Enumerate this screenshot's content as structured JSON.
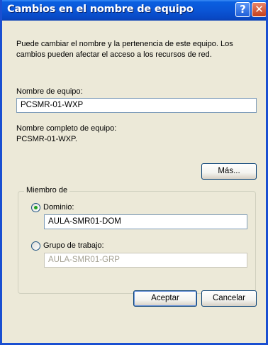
{
  "window": {
    "title": "Cambios en el nombre de equipo",
    "help_glyph": "?",
    "close_glyph": "✕"
  },
  "description": "Puede cambiar el nombre y la pertenencia de este equipo. Los cambios pueden afectar el acceso a los recursos de red.",
  "computer_name": {
    "label": "Nombre de equipo:",
    "value": "PCSMR-01-WXP"
  },
  "full_name": {
    "label": "Nombre completo de equipo:",
    "value": "PCSMR-01-WXP."
  },
  "buttons": {
    "more": "Más...",
    "ok": "Aceptar",
    "cancel": "Cancelar"
  },
  "member_of": {
    "legend": "Miembro de",
    "domain": {
      "label": "Dominio:",
      "value": "AULA-SMR01-DOM",
      "selected": true
    },
    "workgroup": {
      "label": "Grupo de trabajo:",
      "value": "AULA-SMR01-GRP",
      "selected": false
    }
  },
  "colors": {
    "title_bar": "#0a55d6",
    "dialog_face": "#ece9d8",
    "radio_dot": "#21a121"
  }
}
